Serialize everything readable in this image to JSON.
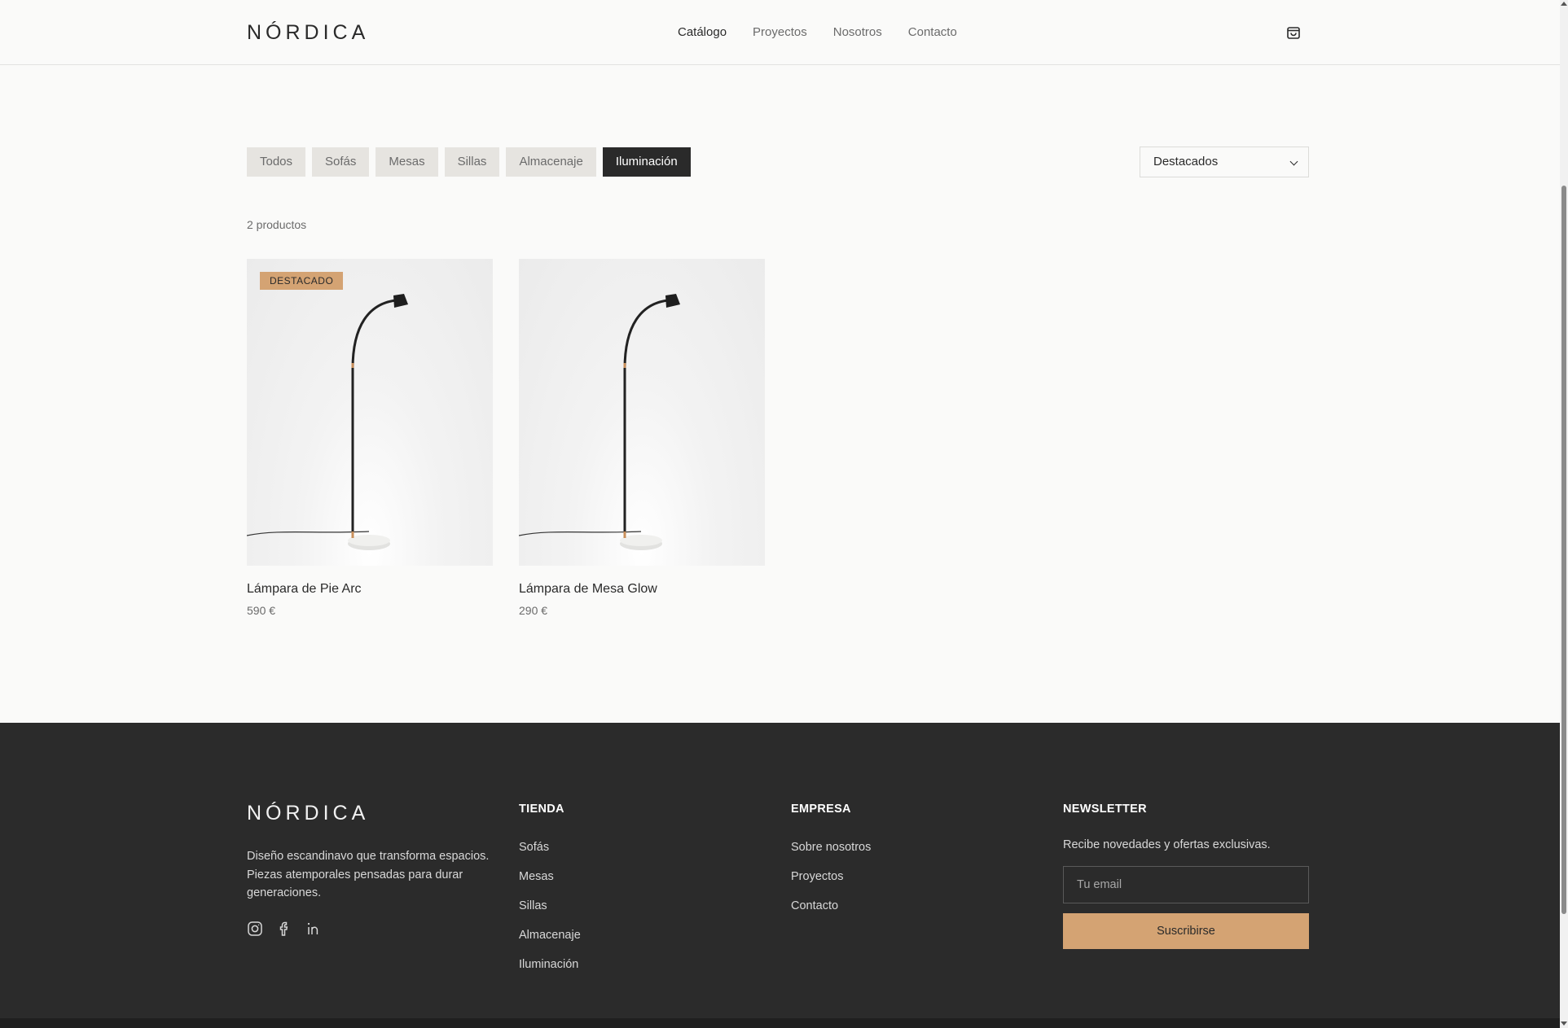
{
  "header": {
    "logo": "NÓRDICA",
    "nav": [
      "Catálogo",
      "Proyectos",
      "Nosotros",
      "Contacto"
    ],
    "active_nav": "Catálogo",
    "cart_icon": "shopping-bag-icon"
  },
  "filters": {
    "chips": [
      "Todos",
      "Sofás",
      "Mesas",
      "Sillas",
      "Almacenaje",
      "Iluminación"
    ],
    "active": "Iluminación",
    "sort_value": "Destacados"
  },
  "results": {
    "count_label": "2 productos"
  },
  "products": [
    {
      "name": "Lámpara de Pie Arc",
      "price": "590 €",
      "badge": "DESTACADO"
    },
    {
      "name": "Lámpara de Mesa Glow",
      "price": "290 €",
      "badge": ""
    }
  ],
  "footer": {
    "logo": "NÓRDICA",
    "description": "Diseño escandinavo que transforma espacios. Piezas atemporales pensadas para durar generaciones.",
    "social_icons": [
      "instagram-icon",
      "facebook-icon",
      "linkedin-icon"
    ],
    "tienda": {
      "title": "TIENDA",
      "links": [
        "Sofás",
        "Mesas",
        "Sillas",
        "Almacenaje",
        "Iluminación"
      ]
    },
    "empresa": {
      "title": "EMPRESA",
      "links": [
        "Sobre nosotros",
        "Proyectos",
        "Contacto"
      ]
    },
    "newsletter": {
      "title": "NEWSLETTER",
      "text": "Recibe novedades y ofertas exclusivas.",
      "placeholder": "Tu email",
      "button": "Suscribirse"
    }
  },
  "colors": {
    "accent": "#d4a373",
    "dark": "#2a2a2a",
    "footer_bg": "#2b2b2b",
    "background": "#fafaf9"
  }
}
